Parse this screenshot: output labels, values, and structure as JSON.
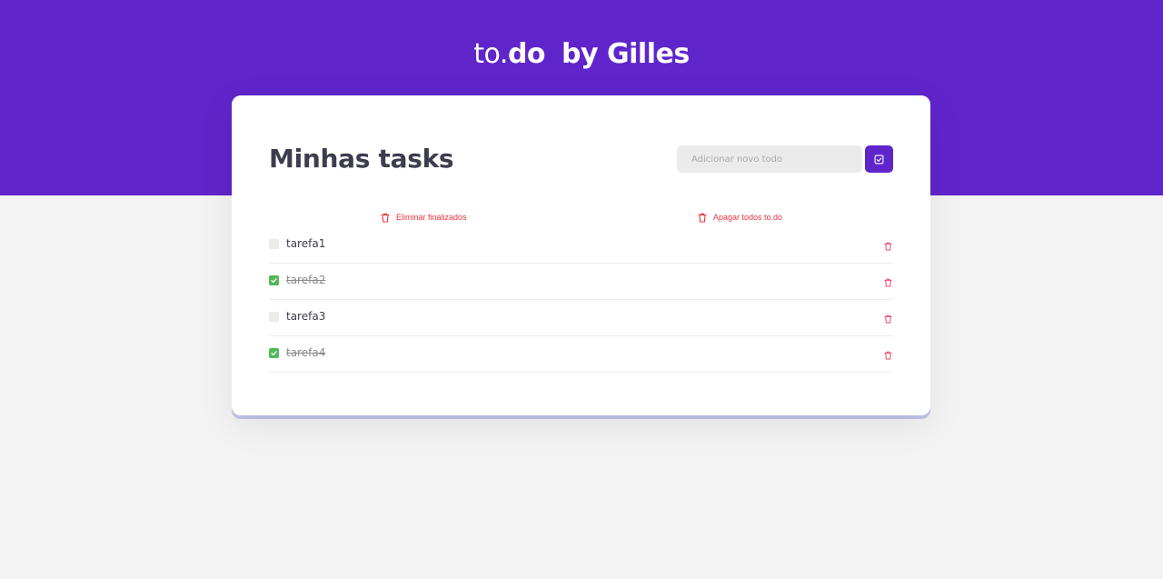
{
  "brand": {
    "prefix": "to.",
    "name": "do",
    "suffix": "by Gilles"
  },
  "card": {
    "title": "Minhas tasks",
    "input_placeholder": "Adicionar novo todo",
    "input_value": "",
    "add_icon": "checkbox-check-icon"
  },
  "actions": {
    "delete_finished": "Eliminar finalizados",
    "delete_all": "Apagar todos to.do"
  },
  "tasks": [
    {
      "text": "tarefa1",
      "done": false
    },
    {
      "text": "tarefa2",
      "done": true
    },
    {
      "text": "tarefa3",
      "done": false
    },
    {
      "text": "tarefa4",
      "done": true
    }
  ],
  "colors": {
    "primary": "#5f25cb",
    "danger": "#e8333c",
    "success": "#52b856",
    "background": "#f3f3f3"
  },
  "icons": {
    "action": "trash-icon",
    "row_delete": "trash-icon",
    "checked": "check-icon"
  }
}
